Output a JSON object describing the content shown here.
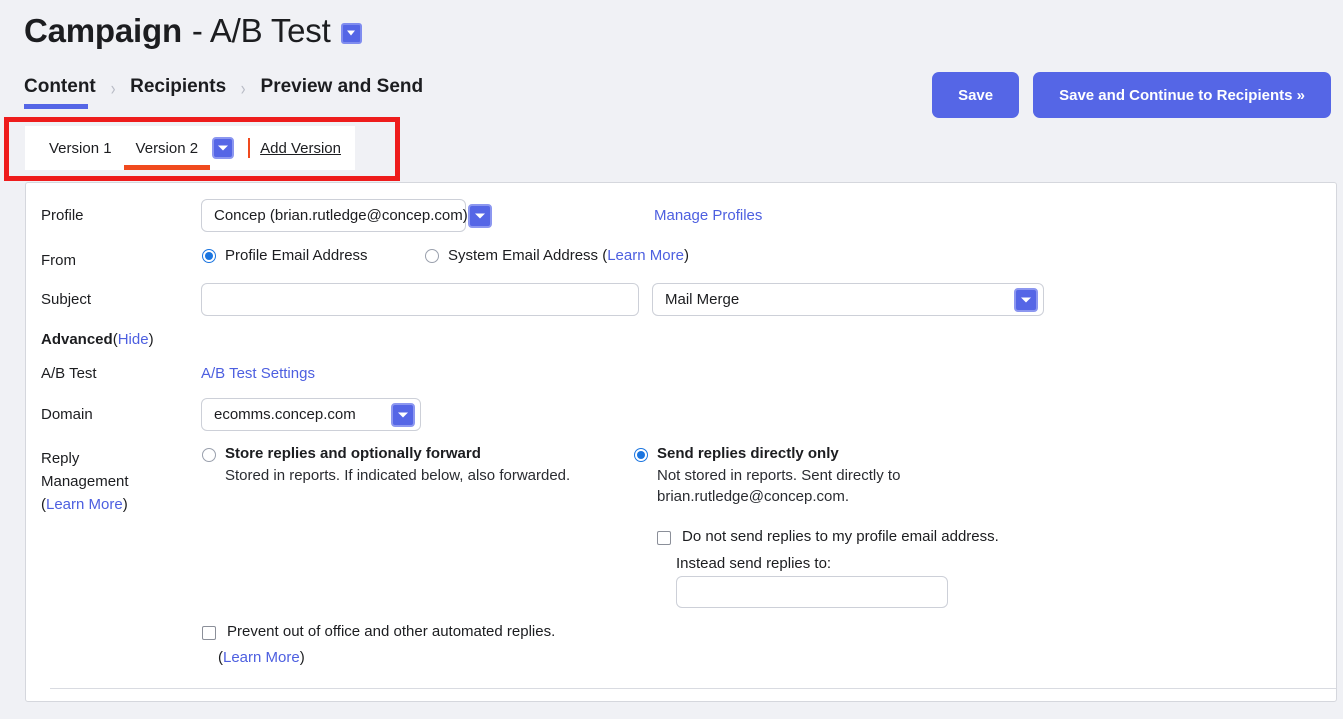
{
  "header": {
    "title_strong": "Campaign",
    "title_light": "- A/B Test",
    "title_caret_icon": "chevron-down-icon",
    "steps": [
      {
        "label": "Content",
        "active": true
      },
      {
        "label": "Recipients",
        "active": false
      },
      {
        "label": "Preview and Send",
        "active": false
      }
    ],
    "step_separator": "›",
    "save_label": "Save",
    "save_continue_label": "Save and Continue to Recipients »"
  },
  "version_bar": {
    "tabs": [
      {
        "label": "Version 1",
        "active": false
      },
      {
        "label": "Version 2",
        "active": true
      }
    ],
    "tab_caret_icon": "chevron-down-icon",
    "separator": "|",
    "add_version_label": "Add Version"
  },
  "form": {
    "profile": {
      "label": "Profile",
      "value": "Concep (brian.rutledge@concep.com)",
      "caret_icon": "chevron-down-icon",
      "manage_link": "Manage Profiles"
    },
    "from": {
      "label": "From",
      "option_profile": "Profile Email Address",
      "option_profile_selected": true,
      "option_system_prefix": "System Email Address (",
      "option_system_link": "Learn More",
      "option_system_suffix": ")"
    },
    "subject": {
      "label": "Subject",
      "value": "",
      "placeholder": "",
      "merge_value": "Mail Merge",
      "merge_caret_icon": "chevron-down-icon"
    },
    "advanced": {
      "label": "Advanced",
      "toggle_open": "(",
      "toggle_link": "Hide",
      "toggle_close": ")"
    },
    "ab_test": {
      "label": "A/B Test",
      "settings_link": "A/B Test Settings"
    },
    "domain": {
      "label": "Domain",
      "value": "ecomms.concep.com",
      "caret_icon": "chevron-down-icon"
    },
    "reply_management": {
      "label_line1": "Reply",
      "label_line2": "Management",
      "label_open": "(",
      "label_link": "Learn More",
      "label_close": ")",
      "store": {
        "title": "Store replies and optionally forward",
        "desc": "Stored in reports. If indicated below, also forwarded.",
        "selected": false
      },
      "direct": {
        "title": "Send replies directly only",
        "desc": "Not stored in reports. Sent directly to brian.rutledge@concep.com.",
        "selected": true,
        "no_profile_label": "Do not send replies to my profile email address.",
        "no_profile_checked": false,
        "instead_label": "Instead send replies to:",
        "instead_value": "",
        "instead_placeholder": ""
      },
      "prevent": {
        "label": "Prevent out of office and other automated replies.",
        "checked": false,
        "learn_open": "(",
        "learn_link": "Learn More",
        "learn_close": ")"
      }
    }
  },
  "colors": {
    "accent_purple": "#5566e6",
    "tab_active_orange": "#f04a1e",
    "annotation_red": "#ee1c1c",
    "radio_blue": "#1b75e0",
    "link_blue": "#4d5fe0",
    "page_bg": "#f0f1f5"
  }
}
